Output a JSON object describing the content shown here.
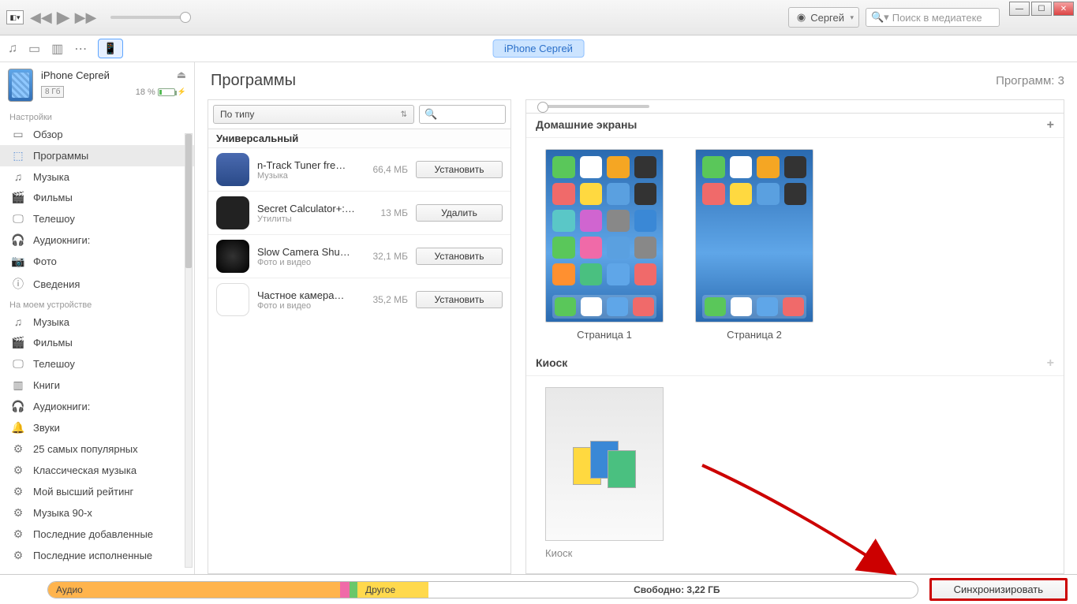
{
  "toolbar": {
    "user_label": "Сергей",
    "search_placeholder": "Поиск в медиатеке"
  },
  "device_pill": "iPhone Сергей",
  "device": {
    "name": "iPhone Сергей",
    "storage": "8 Гб",
    "battery": "18 %"
  },
  "sidebar": {
    "section_settings": "Настройки",
    "settings": [
      "Обзор",
      "Программы",
      "Музыка",
      "Фильмы",
      "Телешоу",
      "Аудиокниги:",
      "Фото",
      "Сведения"
    ],
    "section_device": "На моем устройстве",
    "ondevice": [
      "Музыка",
      "Фильмы",
      "Телешоу",
      "Книги",
      "Аудиокниги:",
      "Звуки",
      "25 самых популярных",
      "Классическая музыка",
      "Мой высший рейтинг",
      "Музыка 90-х",
      "Последние добавленные",
      "Последние исполненные"
    ]
  },
  "content": {
    "title": "Программы",
    "count_label": "Программ: 3",
    "sort_label": "По типу",
    "group_label": "Универсальный",
    "apps": [
      {
        "name": "n-Track Tuner fre…",
        "cat": "Музыка",
        "size": "66,4 МБ",
        "action": "Установить",
        "color": "#3a66a8"
      },
      {
        "name": "Secret  Calculator+:…",
        "cat": "Утилиты",
        "size": "13 МБ",
        "action": "Удалить",
        "color": "#222"
      },
      {
        "name": "Slow Camera Shu…",
        "cat": "Фото и видео",
        "size": "32,1 МБ",
        "action": "Установить",
        "color": "#b03030"
      },
      {
        "name": "Частное камера…",
        "cat": "Фото и видео",
        "size": "35,2 МБ",
        "action": "Установить",
        "color": "#fff"
      }
    ],
    "home_screens_label": "Домашние экраны",
    "pages": [
      "Страница 1",
      "Страница 2"
    ],
    "kiosk_label": "Киоск",
    "kiosk_caption": "Киоск"
  },
  "bottom": {
    "audio_label": "Аудио",
    "other_label": "Другое",
    "free_label": "Свободно: 3,22 ГБ",
    "sync_label": "Синхронизировать"
  }
}
